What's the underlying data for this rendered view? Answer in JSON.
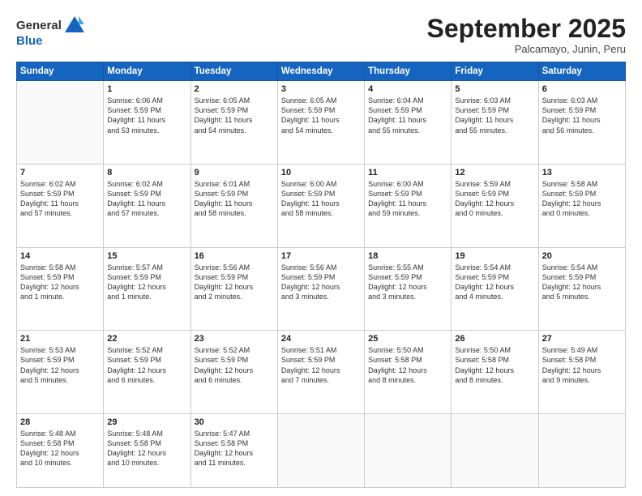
{
  "header": {
    "logo_line1": "General",
    "logo_line2": "Blue",
    "month": "September 2025",
    "location": "Palcamayo, Junin, Peru"
  },
  "weekdays": [
    "Sunday",
    "Monday",
    "Tuesday",
    "Wednesday",
    "Thursday",
    "Friday",
    "Saturday"
  ],
  "weeks": [
    [
      {
        "day": "",
        "text": ""
      },
      {
        "day": "1",
        "text": "Sunrise: 6:06 AM\nSunset: 5:59 PM\nDaylight: 11 hours\nand 53 minutes."
      },
      {
        "day": "2",
        "text": "Sunrise: 6:05 AM\nSunset: 5:59 PM\nDaylight: 11 hours\nand 54 minutes."
      },
      {
        "day": "3",
        "text": "Sunrise: 6:05 AM\nSunset: 5:59 PM\nDaylight: 11 hours\nand 54 minutes."
      },
      {
        "day": "4",
        "text": "Sunrise: 6:04 AM\nSunset: 5:59 PM\nDaylight: 11 hours\nand 55 minutes."
      },
      {
        "day": "5",
        "text": "Sunrise: 6:03 AM\nSunset: 5:59 PM\nDaylight: 11 hours\nand 55 minutes."
      },
      {
        "day": "6",
        "text": "Sunrise: 6:03 AM\nSunset: 5:59 PM\nDaylight: 11 hours\nand 56 minutes."
      }
    ],
    [
      {
        "day": "7",
        "text": "Sunrise: 6:02 AM\nSunset: 5:59 PM\nDaylight: 11 hours\nand 57 minutes."
      },
      {
        "day": "8",
        "text": "Sunrise: 6:02 AM\nSunset: 5:59 PM\nDaylight: 11 hours\nand 57 minutes."
      },
      {
        "day": "9",
        "text": "Sunrise: 6:01 AM\nSunset: 5:59 PM\nDaylight: 11 hours\nand 58 minutes."
      },
      {
        "day": "10",
        "text": "Sunrise: 6:00 AM\nSunset: 5:59 PM\nDaylight: 11 hours\nand 58 minutes."
      },
      {
        "day": "11",
        "text": "Sunrise: 6:00 AM\nSunset: 5:59 PM\nDaylight: 11 hours\nand 59 minutes."
      },
      {
        "day": "12",
        "text": "Sunrise: 5:59 AM\nSunset: 5:59 PM\nDaylight: 12 hours\nand 0 minutes."
      },
      {
        "day": "13",
        "text": "Sunrise: 5:58 AM\nSunset: 5:59 PM\nDaylight: 12 hours\nand 0 minutes."
      }
    ],
    [
      {
        "day": "14",
        "text": "Sunrise: 5:58 AM\nSunset: 5:59 PM\nDaylight: 12 hours\nand 1 minute."
      },
      {
        "day": "15",
        "text": "Sunrise: 5:57 AM\nSunset: 5:59 PM\nDaylight: 12 hours\nand 1 minute."
      },
      {
        "day": "16",
        "text": "Sunrise: 5:56 AM\nSunset: 5:59 PM\nDaylight: 12 hours\nand 2 minutes."
      },
      {
        "day": "17",
        "text": "Sunrise: 5:56 AM\nSunset: 5:59 PM\nDaylight: 12 hours\nand 3 minutes."
      },
      {
        "day": "18",
        "text": "Sunrise: 5:55 AM\nSunset: 5:59 PM\nDaylight: 12 hours\nand 3 minutes."
      },
      {
        "day": "19",
        "text": "Sunrise: 5:54 AM\nSunset: 5:59 PM\nDaylight: 12 hours\nand 4 minutes."
      },
      {
        "day": "20",
        "text": "Sunrise: 5:54 AM\nSunset: 5:59 PM\nDaylight: 12 hours\nand 5 minutes."
      }
    ],
    [
      {
        "day": "21",
        "text": "Sunrise: 5:53 AM\nSunset: 5:59 PM\nDaylight: 12 hours\nand 5 minutes."
      },
      {
        "day": "22",
        "text": "Sunrise: 5:52 AM\nSunset: 5:59 PM\nDaylight: 12 hours\nand 6 minutes."
      },
      {
        "day": "23",
        "text": "Sunrise: 5:52 AM\nSunset: 5:59 PM\nDaylight: 12 hours\nand 6 minutes."
      },
      {
        "day": "24",
        "text": "Sunrise: 5:51 AM\nSunset: 5:59 PM\nDaylight: 12 hours\nand 7 minutes."
      },
      {
        "day": "25",
        "text": "Sunrise: 5:50 AM\nSunset: 5:58 PM\nDaylight: 12 hours\nand 8 minutes."
      },
      {
        "day": "26",
        "text": "Sunrise: 5:50 AM\nSunset: 5:58 PM\nDaylight: 12 hours\nand 8 minutes."
      },
      {
        "day": "27",
        "text": "Sunrise: 5:49 AM\nSunset: 5:58 PM\nDaylight: 12 hours\nand 9 minutes."
      }
    ],
    [
      {
        "day": "28",
        "text": "Sunrise: 5:48 AM\nSunset: 5:58 PM\nDaylight: 12 hours\nand 10 minutes."
      },
      {
        "day": "29",
        "text": "Sunrise: 5:48 AM\nSunset: 5:58 PM\nDaylight: 12 hours\nand 10 minutes."
      },
      {
        "day": "30",
        "text": "Sunrise: 5:47 AM\nSunset: 5:58 PM\nDaylight: 12 hours\nand 11 minutes."
      },
      {
        "day": "",
        "text": ""
      },
      {
        "day": "",
        "text": ""
      },
      {
        "day": "",
        "text": ""
      },
      {
        "day": "",
        "text": ""
      }
    ]
  ]
}
